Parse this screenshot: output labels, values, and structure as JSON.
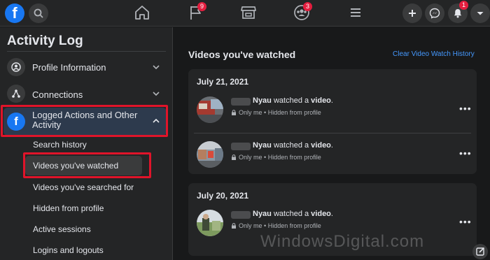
{
  "topbar": {
    "logo_text": "f",
    "notifications": {
      "flag_count": "9",
      "groups_count": "3",
      "bell_count": "1"
    }
  },
  "sidebar": {
    "title": "Activity Log",
    "categories": [
      {
        "label": "Profile Information",
        "icon": "user-circle-icon"
      },
      {
        "label": "Connections",
        "icon": "share-nodes-icon"
      },
      {
        "label": "Logged Actions and Other Activity",
        "icon": "facebook-icon"
      }
    ],
    "sub_items": [
      {
        "label": "Search history"
      },
      {
        "label": "Videos you've watched"
      },
      {
        "label": "Videos you've searched for"
      },
      {
        "label": "Hidden from profile"
      },
      {
        "label": "Active sessions"
      },
      {
        "label": "Logins and logouts"
      }
    ]
  },
  "main": {
    "title": "Videos you've watched",
    "clear_link": "Clear Video Watch History",
    "cards": [
      {
        "date": "July 21, 2021",
        "entries": [
          {
            "name": "Nyau",
            "text": " watched a ",
            "object": "video",
            "end": ".",
            "privacy": "Only me",
            "dot": "•",
            "hidden": "Hidden from profile"
          },
          {
            "name": "Nyau",
            "text": " watched a ",
            "object": "video",
            "end": ".",
            "privacy": "Only me",
            "dot": "•",
            "hidden": "Hidden from profile"
          }
        ]
      },
      {
        "date": "July 20, 2021",
        "entries": [
          {
            "name": "Nyau",
            "text": " watched a ",
            "object": "video",
            "end": ".",
            "privacy": "Only me",
            "dot": "•",
            "hidden": "Hidden from profile"
          }
        ]
      }
    ]
  },
  "watermark": "WindowsDigital.com",
  "colors": {
    "accent": "#1877f2",
    "highlight": "#e0142a",
    "link": "#4599ff",
    "badge": "#e41e3f"
  }
}
